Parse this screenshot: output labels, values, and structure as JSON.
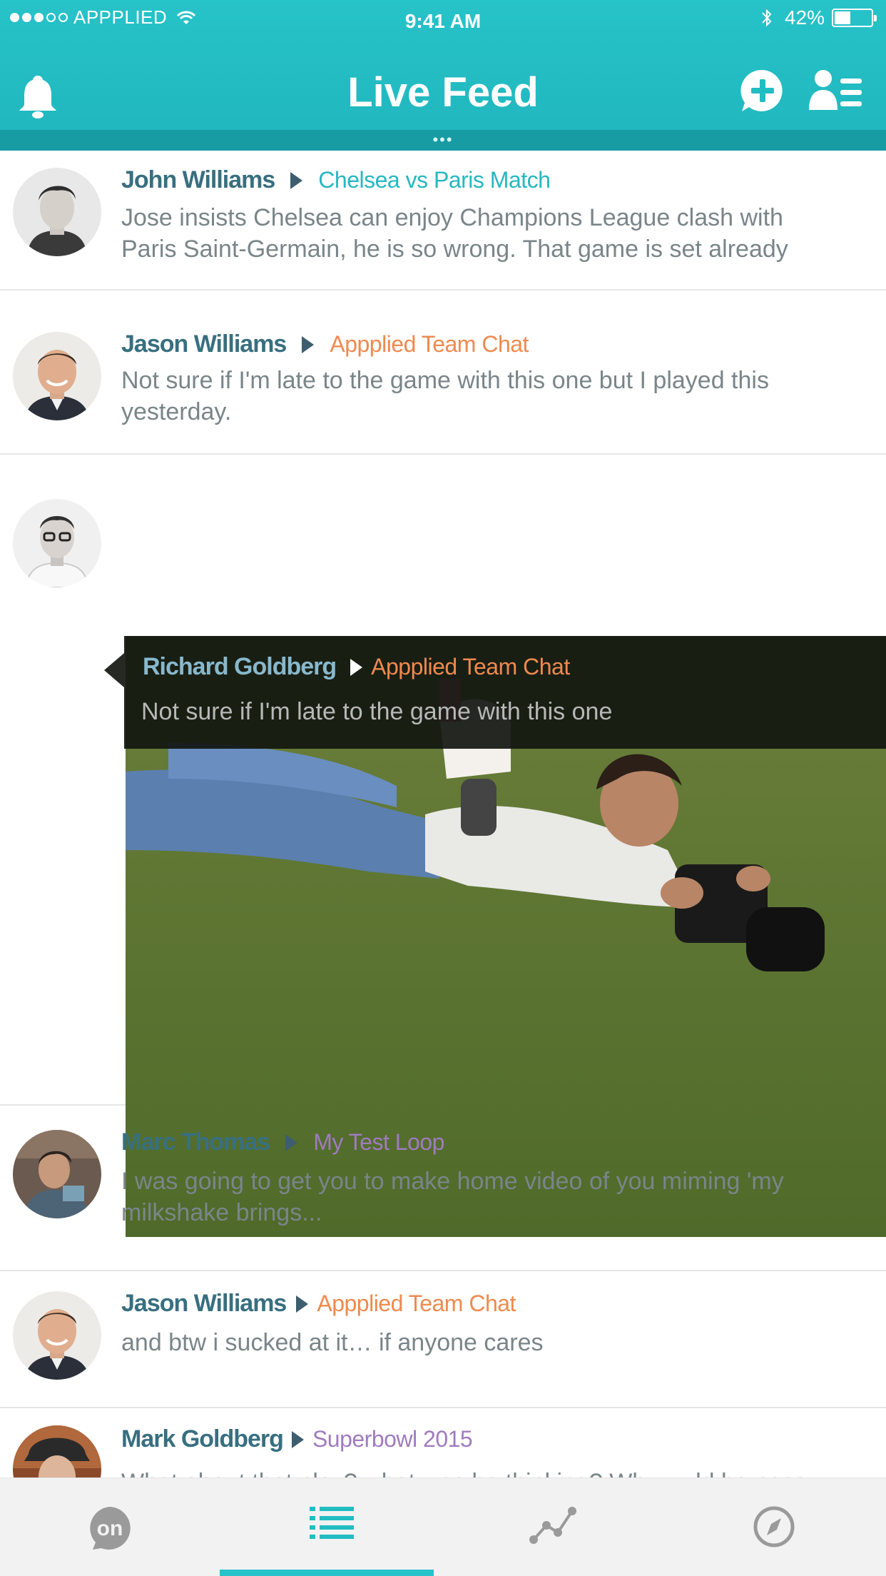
{
  "status_bar": {
    "carrier": "APPPLIED",
    "time": "9:41 AM",
    "battery_percent": "42%",
    "battery_level": 0.42,
    "signal_bars_filled": 3,
    "signal_bars_total": 5
  },
  "header": {
    "title": "Live Feed",
    "icons": [
      "bell-icon",
      "add-chat-icon",
      "contacts-list-icon"
    ],
    "page_dots": "•••",
    "color": "#22bcc3"
  },
  "feed": [
    {
      "name": "John Williams",
      "room": "Chelsea vs Paris Match",
      "room_color": "#25b8c0",
      "message": "Jose insists Chelsea can enjoy Champions League clash with Paris Saint-Germain, he is so wrong. That game is set already"
    },
    {
      "name": "Jason Williams",
      "room": "Appplied Team Chat",
      "room_color": "#ef8a4e",
      "message": "Not sure if I'm late to the game with this one but I played this yesterday."
    },
    {
      "name": "Richard Goldberg",
      "room": "Appplied Team Chat",
      "room_color": "#ef8a4e",
      "message": "Not sure if I'm late to the game with this one",
      "has_photo": true
    },
    {
      "name": "Marc Thomas",
      "room": "My Test Loop",
      "room_color": "#a07bbf",
      "message": "I was going to get you to make home video of you miming 'my milkshake brings..."
    },
    {
      "name": "Jason Williams",
      "room": "Appplied Team Chat",
      "room_color": "#ef8a4e",
      "message": "and btw i sucked at it… if anyone cares"
    },
    {
      "name": "Mark Goldberg",
      "room": "Superbowl 2015",
      "room_color": "#a07bbf",
      "message": "What about that play? what was he thinking? Why wuld he pass the ball when he could have just run it… hmmmm"
    }
  ],
  "tabbar": {
    "tabs": [
      {
        "icon": "on-logo-icon",
        "label": "on"
      },
      {
        "icon": "list-icon",
        "active": true
      },
      {
        "icon": "graph-icon"
      },
      {
        "icon": "compass-icon"
      }
    ],
    "accent": "#26c3c9"
  }
}
